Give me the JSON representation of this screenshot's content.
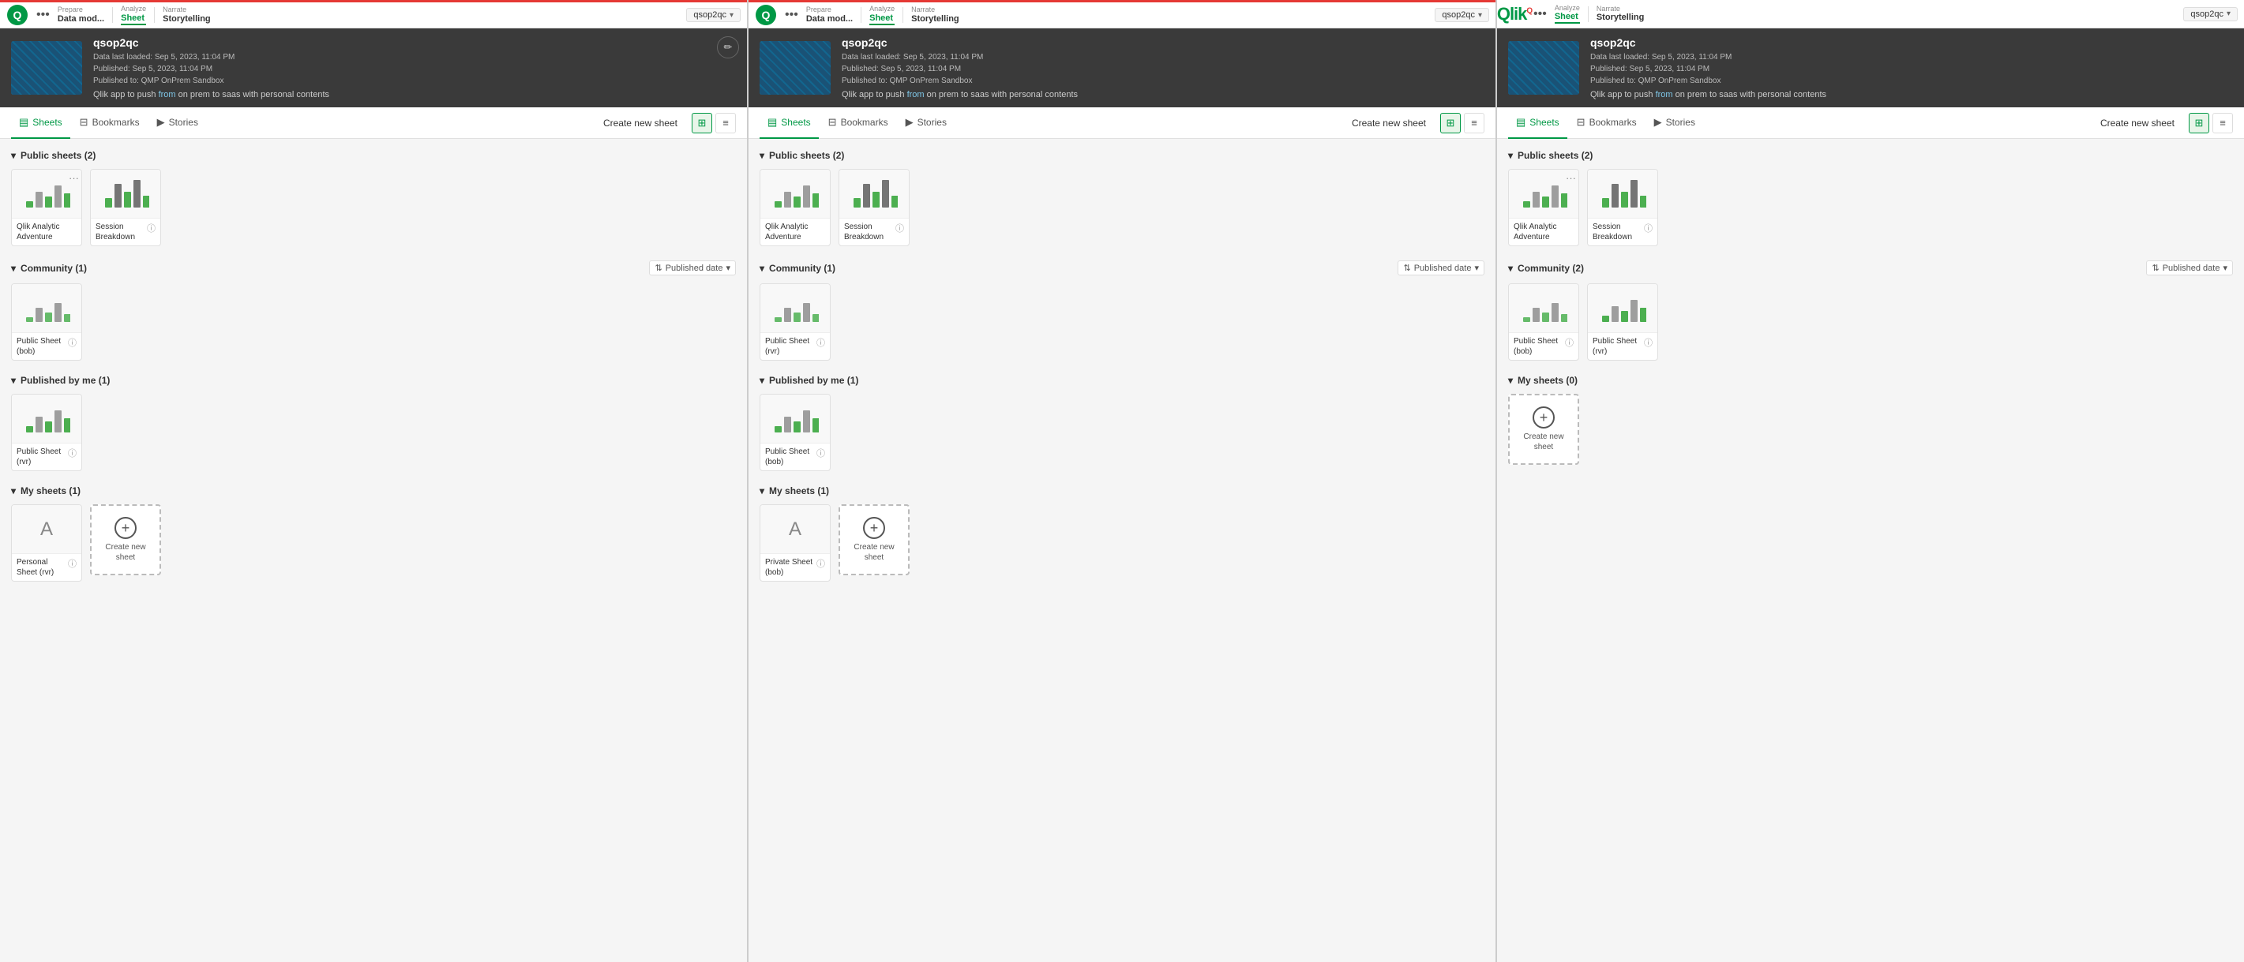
{
  "panels": [
    {
      "id": "panel-1",
      "topbar": {
        "logo": "Q",
        "logo_type": "icon",
        "dots_label": "•••",
        "sections": [
          {
            "label": "Prepare",
            "value": "Data mod...",
            "active": false
          },
          {
            "label": "Analyze",
            "value": "Sheet",
            "active": true
          },
          {
            "label": "Narrate",
            "value": "Storytelling",
            "active": false
          }
        ],
        "badge": "qsop2qc"
      },
      "app": {
        "name": "qsop2qc",
        "meta_line1": "Data last loaded: Sep 5, 2023, 11:04 PM",
        "meta_line2": "Published: Sep 5, 2023, 11:04 PM",
        "meta_line3": "Published to: QMP OnPrem Sandbox",
        "description": "Qlik app to push from on prem to saas with personal contents",
        "show_edit": true
      },
      "tabs": {
        "items": [
          {
            "label": "Sheets",
            "icon": "☰",
            "active": true
          },
          {
            "label": "Bookmarks",
            "icon": "🔖",
            "active": false
          },
          {
            "label": "Stories",
            "icon": "▶",
            "active": false
          }
        ],
        "create_label": "Create new sheet",
        "views": [
          "grid",
          "list"
        ]
      },
      "sections": [
        {
          "title": "Public sheets (2)",
          "collapsible": true,
          "show_sort": false,
          "sheets": [
            {
              "name": "Qlik Analytic Adventure",
              "type": "chart",
              "has_ellipsis": true
            },
            {
              "name": "Session Breakdown",
              "type": "chart",
              "has_info": true
            }
          ]
        },
        {
          "title": "Community (1)",
          "collapsible": true,
          "show_sort": true,
          "sort_label": "Published date",
          "sheets": [
            {
              "name": "Public Sheet (bob)",
              "type": "chart",
              "has_info": true
            }
          ]
        },
        {
          "title": "Published by me (1)",
          "collapsible": true,
          "show_sort": false,
          "sheets": [
            {
              "name": "Public Sheet (rvr)",
              "type": "chart",
              "has_info": true
            }
          ]
        },
        {
          "title": "My sheets (1)",
          "collapsible": true,
          "show_sort": false,
          "sheets": [
            {
              "name": "Personal Sheet (rvr)",
              "type": "personal",
              "has_info": true
            },
            {
              "name": "Create new sheet",
              "type": "create"
            }
          ]
        }
      ]
    },
    {
      "id": "panel-2",
      "topbar": {
        "logo": "Q",
        "logo_type": "icon",
        "dots_label": "•••",
        "sections": [
          {
            "label": "Prepare",
            "value": "Data mod...",
            "active": false
          },
          {
            "label": "Analyze",
            "value": "Sheet",
            "active": true
          },
          {
            "label": "Narrate",
            "value": "Storytelling",
            "active": false
          }
        ],
        "badge": "qsop2qc"
      },
      "app": {
        "name": "qsop2qc",
        "meta_line1": "Data last loaded: Sep 5, 2023, 11:04 PM",
        "meta_line2": "Published: Sep 5, 2023, 11:04 PM",
        "meta_line3": "Published to: QMP OnPrem Sandbox",
        "description": "Qlik app to push from on prem to saas with personal contents",
        "show_edit": false
      },
      "tabs": {
        "items": [
          {
            "label": "Sheets",
            "icon": "☰",
            "active": true
          },
          {
            "label": "Bookmarks",
            "icon": "🔖",
            "active": false
          },
          {
            "label": "Stories",
            "icon": "▶",
            "active": false
          }
        ],
        "create_label": "Create new sheet",
        "views": [
          "grid",
          "list"
        ]
      },
      "sections": [
        {
          "title": "Public sheets (2)",
          "collapsible": true,
          "show_sort": false,
          "sheets": [
            {
              "name": "Qlik Analytic Adventure",
              "type": "chart",
              "has_ellipsis": false
            },
            {
              "name": "Session Breakdown",
              "type": "chart",
              "has_info": true
            }
          ]
        },
        {
          "title": "Community (1)",
          "collapsible": true,
          "show_sort": true,
          "sort_label": "Published date",
          "sheets": [
            {
              "name": "Public Sheet (rvr)",
              "type": "chart",
              "has_info": true
            }
          ]
        },
        {
          "title": "Published by me (1)",
          "collapsible": true,
          "show_sort": false,
          "sheets": [
            {
              "name": "Public Sheet (bob)",
              "type": "chart",
              "has_info": true
            }
          ]
        },
        {
          "title": "My sheets (1)",
          "collapsible": true,
          "show_sort": false,
          "sheets": [
            {
              "name": "Private Sheet (bob)",
              "type": "personal",
              "has_info": true
            },
            {
              "name": "Create new sheet",
              "type": "create"
            }
          ]
        }
      ]
    },
    {
      "id": "panel-3",
      "topbar": {
        "logo": "Qlik",
        "logo_type": "full",
        "dots_label": "•••",
        "sections": [
          {
            "label": "Analyze",
            "value": "Sheet",
            "active": true
          },
          {
            "label": "Narrate",
            "value": "Storytelling",
            "active": false
          }
        ],
        "badge": "qsop2qc"
      },
      "app": {
        "name": "qsop2qc",
        "meta_line1": "Data last loaded: Sep 5, 2023, 11:04 PM",
        "meta_line2": "Published: Sep 5, 2023, 11:04 PM",
        "meta_line3": "Published to: QMP OnPrem Sandbox",
        "description": "Qlik app to push from on prem to saas with personal contents",
        "show_edit": false
      },
      "tabs": {
        "items": [
          {
            "label": "Sheets",
            "icon": "☰",
            "active": true
          },
          {
            "label": "Bookmarks",
            "icon": "🔖",
            "active": false
          },
          {
            "label": "Stories",
            "icon": "▶",
            "active": false
          }
        ],
        "create_label": "Create new sheet",
        "views": [
          "grid",
          "list"
        ]
      },
      "sections": [
        {
          "title": "Public sheets (2)",
          "collapsible": true,
          "show_sort": false,
          "sheets": [
            {
              "name": "Qlik Analytic Adventure",
              "type": "chart",
              "has_ellipsis": true
            },
            {
              "name": "Session Breakdown",
              "type": "chart",
              "has_info": true
            }
          ]
        },
        {
          "title": "Community (2)",
          "collapsible": true,
          "show_sort": true,
          "sort_label": "Published date",
          "sheets": [
            {
              "name": "Public Sheet (bob)",
              "type": "chart",
              "has_info": true
            },
            {
              "name": "Public Sheet (rvr)",
              "type": "chart",
              "has_info": true
            }
          ]
        },
        {
          "title": "My sheets (0)",
          "collapsible": true,
          "show_sort": false,
          "sheets": [
            {
              "name": "Create new sheet",
              "type": "create"
            }
          ]
        }
      ]
    }
  ],
  "icons": {
    "chevron_down": "▾",
    "chevron_right": "▸",
    "edit": "✏",
    "info": "ⓘ",
    "grid_view": "⊞",
    "list_view": "≡",
    "sort": "⇅",
    "plus": "+",
    "dots": "•••",
    "bookmark": "🔖",
    "story": "▶",
    "sheet": "☰"
  }
}
